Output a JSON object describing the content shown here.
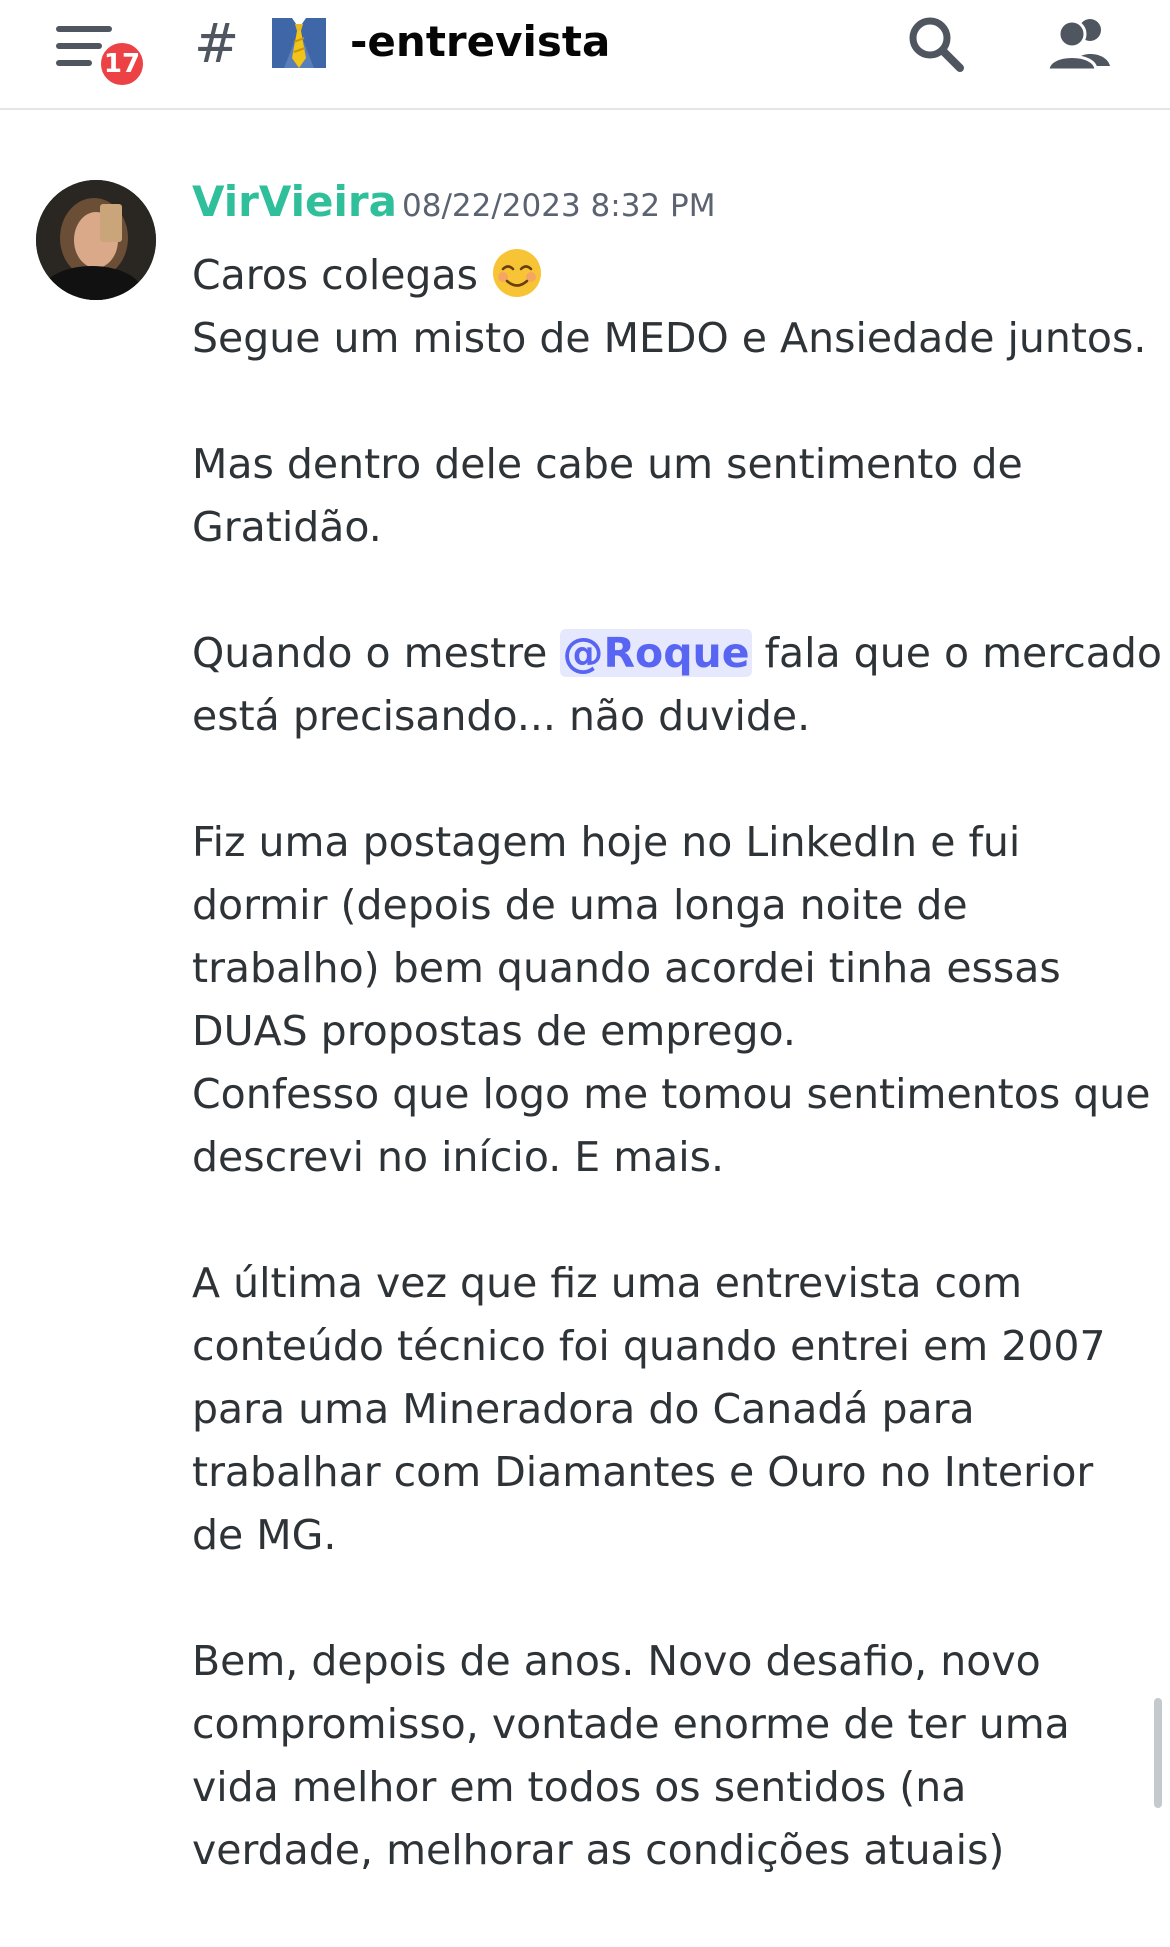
{
  "header": {
    "unread_badge": "17",
    "channel_prefix": "#",
    "channel_emoji": "necktie-emoji",
    "channel_name": "-entrevista",
    "icons": {
      "menu": "hamburger-menu-icon",
      "search": "search-icon",
      "members": "members-icon"
    }
  },
  "message": {
    "author": "VirVieira",
    "author_color": "#2fbf9a",
    "timestamp": "08/22/2023 8:32 PM",
    "line_greeting": "Caros colegas",
    "greeting_emoji": "relaxed-smiling-face-emoji",
    "line_02": "Segue um misto de MEDO e Ansiedade juntos.",
    "line_03": "Mas dentro dele cabe um sentimento de",
    "line_04": "Gratidão.",
    "line_05_pre": "Quando o mestre ",
    "mention": "@Roque",
    "line_05_post": " fala que o mercado",
    "line_06": "está precisando... não duvide.",
    "line_07": "Fiz uma postagem hoje no LinkedIn e fui",
    "line_08": "dormir (depois de uma longa noite de",
    "line_09": "trabalho) bem quando acordei tinha essas",
    "line_10": "DUAS propostas de emprego.",
    "line_11": "Confesso que logo me tomou sentimentos que",
    "line_12": "descrevi no início. E mais.",
    "line_13": "A última vez que fiz uma entrevista com",
    "line_14": "conteúdo técnico foi quando entrei em 2007",
    "line_15": "para uma Mineradora do Canadá para",
    "line_16": "trabalhar com Diamantes e Ouro no Interior",
    "line_17": "de MG.",
    "line_18": "Bem, depois de anos. Novo desafio, novo",
    "line_19": "compromisso, vontade enorme de ter uma",
    "line_20": "vida melhor em todos os sentidos (na",
    "line_21": "verdade, melhorar as condições atuais)"
  },
  "colors": {
    "mention_bg": "#e6e8fd",
    "mention_text": "#5865f2",
    "badge": "#ed4245"
  }
}
